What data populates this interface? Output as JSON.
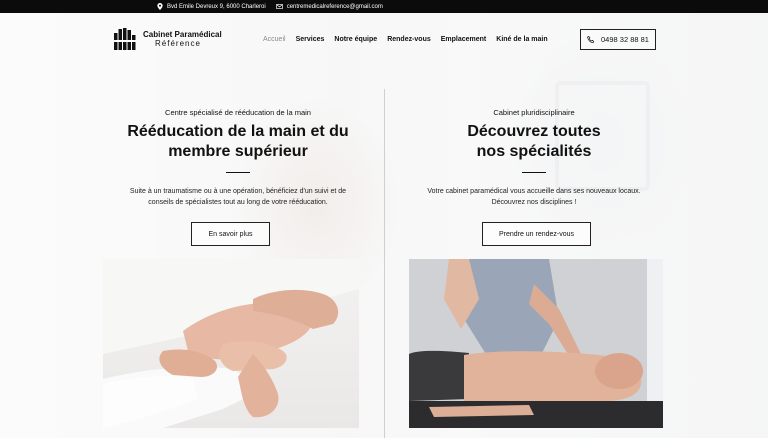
{
  "topbar": {
    "address": "Bvd Emile Devreux 9, 6000 Charleroi",
    "email": "centremedicalreference@gmail.com"
  },
  "logo": {
    "line1": "Cabinet Paramédical",
    "line2": "Référence"
  },
  "nav": {
    "items": [
      {
        "label": "Accueil",
        "active": true
      },
      {
        "label": "Services"
      },
      {
        "label": "Notre équipe"
      },
      {
        "label": "Rendez-vous"
      },
      {
        "label": "Emplacement"
      },
      {
        "label": "Kiné de la main"
      }
    ]
  },
  "phone": {
    "number": "0498 32 88 81"
  },
  "left": {
    "eyebrow": "Centre spécialisé de rééducation de la main",
    "title_line1": "Rééducation de la main et du",
    "title_line2": "membre supérieur",
    "desc_line1": "Suite à un traumatisme ou à une opération, bénéficiez d'un suivi et de",
    "desc_line2": "conseils de spécialistes tout au long de votre rééducation.",
    "button": "En savoir plus"
  },
  "right": {
    "eyebrow": "Cabinet pluridisciplinaire",
    "title_line1": "Découvrez toutes",
    "title_line2": "nos spécialités",
    "desc_line1": "Votre cabinet paramédical vous accueille dans ses nouveaux locaux.",
    "desc_line2": "Découvrez nos disciplines !",
    "button": "Prendre un rendez-vous"
  },
  "colors": {
    "topbar": "#0b0b0b",
    "text": "#111111",
    "muted_nav": "#8a8a8a"
  },
  "icons": [
    "location-pin-icon",
    "envelope-icon",
    "phone-icon",
    "hand-logo-icon"
  ]
}
